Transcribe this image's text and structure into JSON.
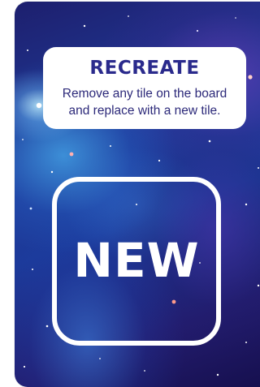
{
  "card": {
    "title": "RECREATE",
    "description_line1": "Remove any tile on the board",
    "description_line2": "and replace with a new tile.",
    "tile_label": "NEW"
  },
  "colors": {
    "title": "#2a2a8c",
    "description": "#2d2a7a",
    "space_dark": "#150f4d",
    "space_blue": "#203c9a",
    "tile_outline": "#ffffff"
  }
}
